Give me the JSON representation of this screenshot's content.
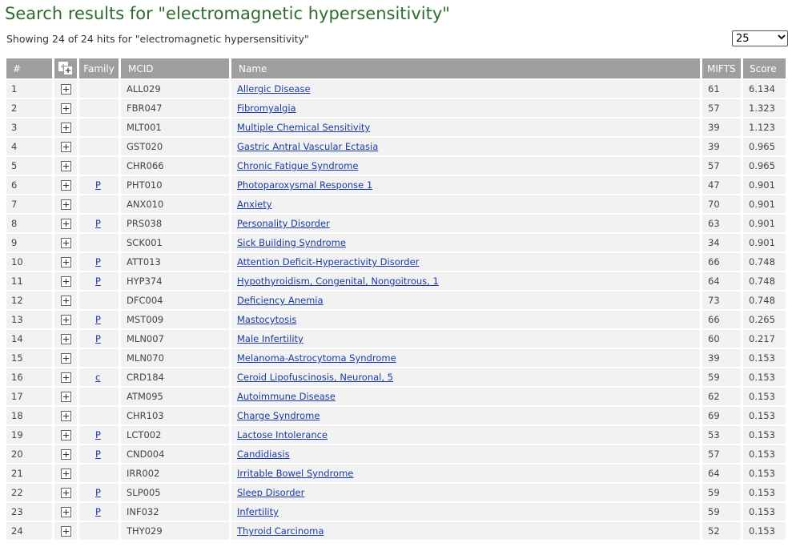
{
  "title": "Search results for \"electromagnetic hypersensitivity\"",
  "summary": "Showing 24 of 24 hits for \"electromagnetic hypersensitivity\"",
  "page_size": {
    "selected": "25"
  },
  "columns": {
    "num": "#",
    "expand_icon": "expand-all-icon",
    "family": "Family",
    "mcid": "MCID",
    "name": "Name",
    "mifts": "MIFTS",
    "score": "Score"
  },
  "rows": [
    {
      "num": "1",
      "family": "",
      "mcid": "ALL029",
      "name": "Allergic Disease",
      "mifts": "61",
      "score": "6.134"
    },
    {
      "num": "2",
      "family": "",
      "mcid": "FBR047",
      "name": "Fibromyalgia",
      "mifts": "57",
      "score": "1.323"
    },
    {
      "num": "3",
      "family": "",
      "mcid": "MLT001",
      "name": "Multiple Chemical Sensitivity",
      "mifts": "39",
      "score": "1.123"
    },
    {
      "num": "4",
      "family": "",
      "mcid": "GST020",
      "name": "Gastric Antral Vascular Ectasia",
      "mifts": "39",
      "score": "0.965"
    },
    {
      "num": "5",
      "family": "",
      "mcid": "CHR066",
      "name": "Chronic Fatigue Syndrome",
      "mifts": "57",
      "score": "0.965"
    },
    {
      "num": "6",
      "family": "P",
      "mcid": "PHT010",
      "name": "Photoparoxysmal Response 1",
      "mifts": "47",
      "score": "0.901"
    },
    {
      "num": "7",
      "family": "",
      "mcid": "ANX010",
      "name": "Anxiety",
      "mifts": "70",
      "score": "0.901"
    },
    {
      "num": "8",
      "family": "P",
      "mcid": "PRS038",
      "name": "Personality Disorder",
      "mifts": "63",
      "score": "0.901"
    },
    {
      "num": "9",
      "family": "",
      "mcid": "SCK001",
      "name": "Sick Building Syndrome",
      "mifts": "34",
      "score": "0.901"
    },
    {
      "num": "10",
      "family": "P",
      "mcid": "ATT013",
      "name": "Attention Deficit-Hyperactivity Disorder",
      "mifts": "66",
      "score": "0.748"
    },
    {
      "num": "11",
      "family": "P",
      "mcid": "HYP374",
      "name": "Hypothyroidism, Congenital, Nongoitrous, 1",
      "mifts": "64",
      "score": "0.748"
    },
    {
      "num": "12",
      "family": "",
      "mcid": "DFC004",
      "name": "Deficiency Anemia",
      "mifts": "73",
      "score": "0.748"
    },
    {
      "num": "13",
      "family": "P",
      "mcid": "MST009",
      "name": "Mastocytosis",
      "mifts": "66",
      "score": "0.265"
    },
    {
      "num": "14",
      "family": "P",
      "mcid": "MLN007",
      "name": "Male Infertility",
      "mifts": "60",
      "score": "0.217"
    },
    {
      "num": "15",
      "family": "",
      "mcid": "MLN070",
      "name": "Melanoma-Astrocytoma Syndrome",
      "mifts": "39",
      "score": "0.153"
    },
    {
      "num": "16",
      "family": "c",
      "mcid": "CRD184",
      "name": "Ceroid Lipofuscinosis, Neuronal, 5",
      "mifts": "59",
      "score": "0.153"
    },
    {
      "num": "17",
      "family": "",
      "mcid": "ATM095",
      "name": "Autoimmune Disease",
      "mifts": "62",
      "score": "0.153"
    },
    {
      "num": "18",
      "family": "",
      "mcid": "CHR103",
      "name": "Charge Syndrome",
      "mifts": "69",
      "score": "0.153"
    },
    {
      "num": "19",
      "family": "P",
      "mcid": "LCT002",
      "name": "Lactose Intolerance",
      "mifts": "53",
      "score": "0.153"
    },
    {
      "num": "20",
      "family": "P",
      "mcid": "CND004",
      "name": "Candidiasis",
      "mifts": "57",
      "score": "0.153"
    },
    {
      "num": "21",
      "family": "",
      "mcid": "IRR002",
      "name": "Irritable Bowel Syndrome",
      "mifts": "64",
      "score": "0.153"
    },
    {
      "num": "22",
      "family": "P",
      "mcid": "SLP005",
      "name": "Sleep Disorder",
      "mifts": "59",
      "score": "0.153"
    },
    {
      "num": "23",
      "family": "P",
      "mcid": "INF032",
      "name": "Infertility",
      "mifts": "59",
      "score": "0.153"
    },
    {
      "num": "24",
      "family": "",
      "mcid": "THY029",
      "name": "Thyroid Carcinoma",
      "mifts": "52",
      "score": "0.153"
    }
  ],
  "colors": {
    "title": "#2e6b2e",
    "header_bg": "#9e9e9e",
    "row_bg": "#f2f2f2",
    "link": "#1a3aa8"
  },
  "icons": {
    "row_expand": "plus-box-icon",
    "select_arrow": "chevron-down-icon"
  }
}
